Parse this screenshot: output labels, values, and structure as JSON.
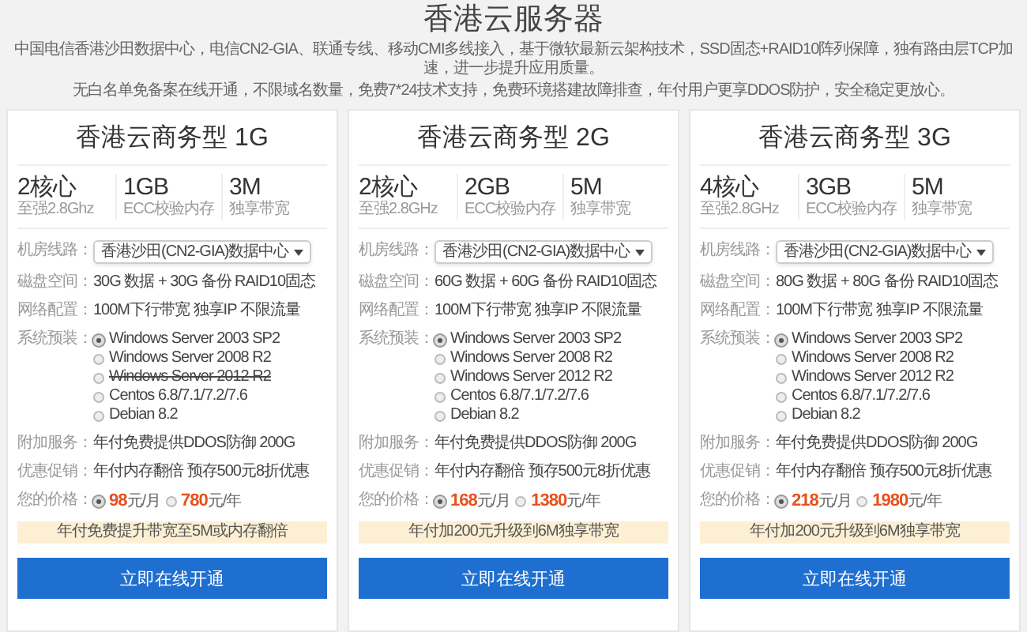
{
  "header": {
    "title": "香港云服务器",
    "intro": [
      "中国电信香港沙田数据中心，电信CN2-GIA、联通专线、移动CMI多线接入，基于微软最新云架构技术，SSD固态+RAID10阵列保障，独有路由层TCP加速，进一步提升应用质量。",
      "无白名单免备案在线开通，不限域名数量，免费7*24技术支持，免费环境搭建故障排查，年付用户更享DDOS防护，安全稳定更放心。"
    ]
  },
  "plans": [
    {
      "title": "香港云商务型 1G",
      "specs": [
        {
          "value": "2核心",
          "caption": "至强2.8Ghz"
        },
        {
          "value": "1GB",
          "caption": "ECC校验内存"
        },
        {
          "value": "3M",
          "caption": "独享带宽"
        }
      ],
      "fields": [
        {
          "kind": "select",
          "label": "机房线路：",
          "value": "香港沙田(CN2-GIA)数据中心"
        },
        {
          "kind": "text",
          "label": "磁盘空间：",
          "value": "30G 数据 + 30G 备份 RAID10固态"
        },
        {
          "kind": "text",
          "label": "网络配置：",
          "value": "100M下行带宽 独享IP 不限流量"
        },
        {
          "kind": "radios",
          "label": "系统预装：",
          "options": [
            {
              "text": "Windows Server 2003 SP2",
              "selected": true,
              "disabled": false
            },
            {
              "text": "Windows Server 2008 R2",
              "selected": false,
              "disabled": false
            },
            {
              "text": "Windows Server 2012 R2",
              "selected": false,
              "disabled": true
            },
            {
              "text": "Centos 6.8/7.1/7.2/7.6",
              "selected": false,
              "disabled": false
            },
            {
              "text": "Debian 8.2",
              "selected": false,
              "disabled": false
            }
          ]
        },
        {
          "kind": "text",
          "label": "附加服务：",
          "value": "年付免费提供DDOS防御 200G"
        },
        {
          "kind": "text",
          "label": "优惠促销：",
          "value": "年付内存翻倍 预存500元8折优惠"
        },
        {
          "kind": "price",
          "label": "您的价格：",
          "options": [
            {
              "amount": "98",
              "unit": "元/月",
              "selected": true
            },
            {
              "amount": "780",
              "unit": "元/年",
              "selected": false
            }
          ]
        }
      ],
      "note": "年付免费提升带宽至5M或内存翻倍",
      "button": "立即在线开通"
    },
    {
      "title": "香港云商务型 2G",
      "specs": [
        {
          "value": "2核心",
          "caption": "至强2.8GHz"
        },
        {
          "value": "2GB",
          "caption": "ECC校验内存"
        },
        {
          "value": "5M",
          "caption": "独享带宽"
        }
      ],
      "fields": [
        {
          "kind": "select",
          "label": "机房线路：",
          "value": "香港沙田(CN2-GIA)数据中心"
        },
        {
          "kind": "text",
          "label": "磁盘空间：",
          "value": "60G 数据 + 60G 备份 RAID10固态"
        },
        {
          "kind": "text",
          "label": "网络配置：",
          "value": "100M下行带宽 独享IP 不限流量"
        },
        {
          "kind": "radios",
          "label": "系统预装：",
          "options": [
            {
              "text": "Windows Server 2003 SP2",
              "selected": true,
              "disabled": false
            },
            {
              "text": "Windows Server 2008 R2",
              "selected": false,
              "disabled": false
            },
            {
              "text": "Windows Server 2012 R2",
              "selected": false,
              "disabled": false
            },
            {
              "text": "Centos 6.8/7.1/7.2/7.6",
              "selected": false,
              "disabled": false
            },
            {
              "text": "Debian 8.2",
              "selected": false,
              "disabled": false
            }
          ]
        },
        {
          "kind": "text",
          "label": "附加服务：",
          "value": "年付免费提供DDOS防御 200G"
        },
        {
          "kind": "text",
          "label": "优惠促销：",
          "value": "年付内存翻倍 预存500元8折优惠"
        },
        {
          "kind": "price",
          "label": "您的价格：",
          "options": [
            {
              "amount": "168",
              "unit": "元/月",
              "selected": true
            },
            {
              "amount": "1380",
              "unit": "元/年",
              "selected": false
            }
          ]
        }
      ],
      "note": "年付加200元升级到6M独享带宽",
      "button": "立即在线开通"
    },
    {
      "title": "香港云商务型 3G",
      "specs": [
        {
          "value": "4核心",
          "caption": "至强2.8GHz"
        },
        {
          "value": "3GB",
          "caption": "ECC校验内存"
        },
        {
          "value": "5M",
          "caption": "独享带宽"
        }
      ],
      "fields": [
        {
          "kind": "select",
          "label": "机房线路：",
          "value": "香港沙田(CN2-GIA)数据中心"
        },
        {
          "kind": "text",
          "label": "磁盘空间：",
          "value": "80G 数据 + 80G 备份 RAID10固态"
        },
        {
          "kind": "text",
          "label": "网络配置：",
          "value": "100M下行带宽 独享IP 不限流量"
        },
        {
          "kind": "radios",
          "label": "系统预装：",
          "options": [
            {
              "text": "Windows Server 2003 SP2",
              "selected": true,
              "disabled": false
            },
            {
              "text": "Windows Server 2008 R2",
              "selected": false,
              "disabled": false
            },
            {
              "text": "Windows Server 2012 R2",
              "selected": false,
              "disabled": false
            },
            {
              "text": "Centos 6.8/7.1/7.2/7.6",
              "selected": false,
              "disabled": false
            },
            {
              "text": "Debian 8.2",
              "selected": false,
              "disabled": false
            }
          ]
        },
        {
          "kind": "text",
          "label": "附加服务：",
          "value": "年付免费提供DDOS防御 200G"
        },
        {
          "kind": "text",
          "label": "优惠促销：",
          "value": "年付内存翻倍 预存500元8折优惠"
        },
        {
          "kind": "price",
          "label": "您的价格：",
          "options": [
            {
              "amount": "218",
              "unit": "元/月",
              "selected": true
            },
            {
              "amount": "1980",
              "unit": "元/年",
              "selected": false
            }
          ]
        }
      ],
      "note": "年付加200元升级到6M独享带宽",
      "button": "立即在线开通"
    }
  ]
}
